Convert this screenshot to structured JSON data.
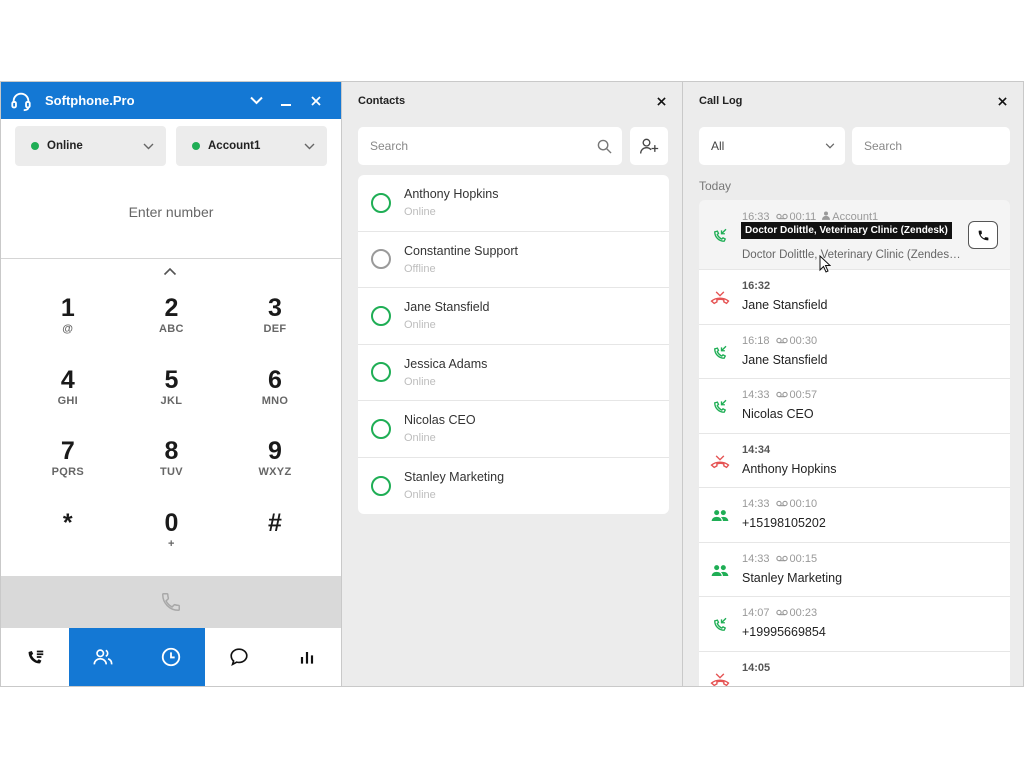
{
  "phone": {
    "title": "Softphone.Pro",
    "status": "Online",
    "account": "Account1",
    "number_placeholder": "Enter number",
    "keys": [
      {
        "digit": "1",
        "letters": "@"
      },
      {
        "digit": "2",
        "letters": "ABC"
      },
      {
        "digit": "3",
        "letters": "DEF"
      },
      {
        "digit": "4",
        "letters": "GHI"
      },
      {
        "digit": "5",
        "letters": "JKL"
      },
      {
        "digit": "6",
        "letters": "MNO"
      },
      {
        "digit": "7",
        "letters": "PQRS"
      },
      {
        "digit": "8",
        "letters": "TUV"
      },
      {
        "digit": "9",
        "letters": "WXYZ"
      },
      {
        "digit": "*",
        "letters": ""
      },
      {
        "digit": "0",
        "letters": "+"
      },
      {
        "digit": "#",
        "letters": ""
      }
    ],
    "nav": [
      {
        "icon": "call-list-icon",
        "active": false
      },
      {
        "icon": "contacts-icon",
        "active": true
      },
      {
        "icon": "history-icon",
        "active": true
      },
      {
        "icon": "chat-icon",
        "active": false
      },
      {
        "icon": "stats-icon",
        "active": false
      }
    ],
    "colors": {
      "accent": "#1478d4",
      "online": "#1fae55"
    }
  },
  "contacts": {
    "title": "Contacts",
    "search_placeholder": "Search",
    "items": [
      {
        "name": "Anthony Hopkins",
        "status": "Online"
      },
      {
        "name": "Constantine  Support",
        "status": "Offline"
      },
      {
        "name": "Jane Stansfield",
        "status": "Online"
      },
      {
        "name": "Jessica Adams",
        "status": "Online"
      },
      {
        "name": "Nicolas CEO",
        "status": "Online"
      },
      {
        "name": "Stanley Marketing",
        "status": "Online"
      }
    ]
  },
  "calllog": {
    "title": "Call Log",
    "filter": "All",
    "search_placeholder": "Search",
    "day": "Today",
    "tooltip": "Doctor Dolittle, Veterinary Clinic (Zendesk)",
    "entries": [
      {
        "type": "incoming",
        "time": "16:33",
        "duration": "00:11",
        "account": "Account1",
        "name": "Doctor Dolittle, Veterinary Clinic (Zendes…"
      },
      {
        "type": "missed",
        "time": "16:32",
        "duration": "",
        "name": "Jane Stansfield"
      },
      {
        "type": "incoming",
        "time": "16:18",
        "duration": "00:30",
        "name": "Jane Stansfield"
      },
      {
        "type": "incoming",
        "time": "14:33",
        "duration": "00:57",
        "name": "Nicolas CEO"
      },
      {
        "type": "missed",
        "time": "14:34",
        "duration": "",
        "name": "Anthony Hopkins"
      },
      {
        "type": "conference",
        "time": "14:33",
        "duration": "00:10",
        "name": "+15198105202"
      },
      {
        "type": "conference",
        "time": "14:33",
        "duration": "00:15",
        "name": "Stanley Marketing"
      },
      {
        "type": "incoming",
        "time": "14:07",
        "duration": "00:23",
        "name": "+19995669854"
      },
      {
        "type": "missed",
        "time": "14:05",
        "duration": "",
        "name": ""
      }
    ]
  }
}
